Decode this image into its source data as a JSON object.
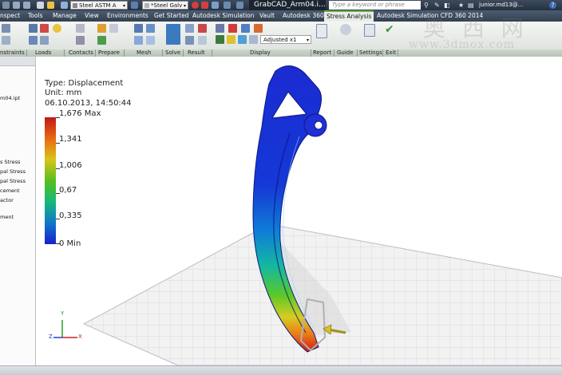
{
  "quick_access": {
    "material_dropdown": "Steel ASTM A",
    "appearance_dropdown": "*Steel Galv",
    "window_title": "GrabCAD_Arm04.i...",
    "search_placeholder": "Type a keyword or phrase",
    "user": "junior.md13@..."
  },
  "tabs": [
    {
      "label": "nspect"
    },
    {
      "label": "Tools"
    },
    {
      "label": "Manage"
    },
    {
      "label": "View"
    },
    {
      "label": "Environments"
    },
    {
      "label": "Get Started"
    },
    {
      "label": "Autodesk Simulation"
    },
    {
      "label": "Vault"
    },
    {
      "label": "Autodesk 360"
    },
    {
      "label": "Stress Analysis"
    },
    {
      "label": "Autodesk Simulation CFD 360 2014"
    }
  ],
  "active_tab": "Stress Analysis",
  "ribbon": {
    "adjust_dropdown": "Adjusted x1"
  },
  "ribbon_groups": [
    "nstraints",
    "Loads",
    "Contacts",
    "Prepare",
    "Mesh",
    "Solve",
    "Result",
    "Display",
    "Report",
    "Guide",
    "Settings",
    "Exit"
  ],
  "browser": {
    "items": [
      "m04.ipt",
      "s Stress",
      "pal Stress",
      "pal Stress",
      "cement",
      "actor",
      "ment"
    ]
  },
  "result": {
    "type_line": "Type: Displacement",
    "unit_line": "Unit: mm",
    "date_line": "06.10.2013, 14:50:44",
    "legend_labels": [
      "1,676 Max",
      "1,341",
      "1,006",
      "0,67",
      "0,335",
      "0 Min"
    ]
  },
  "triad": {
    "x": "X",
    "y": "Y",
    "z": "Z"
  },
  "watermark": {
    "chinese": "奥 西 网",
    "url": "www.3dmox.com"
  },
  "colors": {
    "max": "#c01818",
    "mid": "#56c01c",
    "min": "#1622c8",
    "active_tab_accent": "#6ab04c"
  }
}
